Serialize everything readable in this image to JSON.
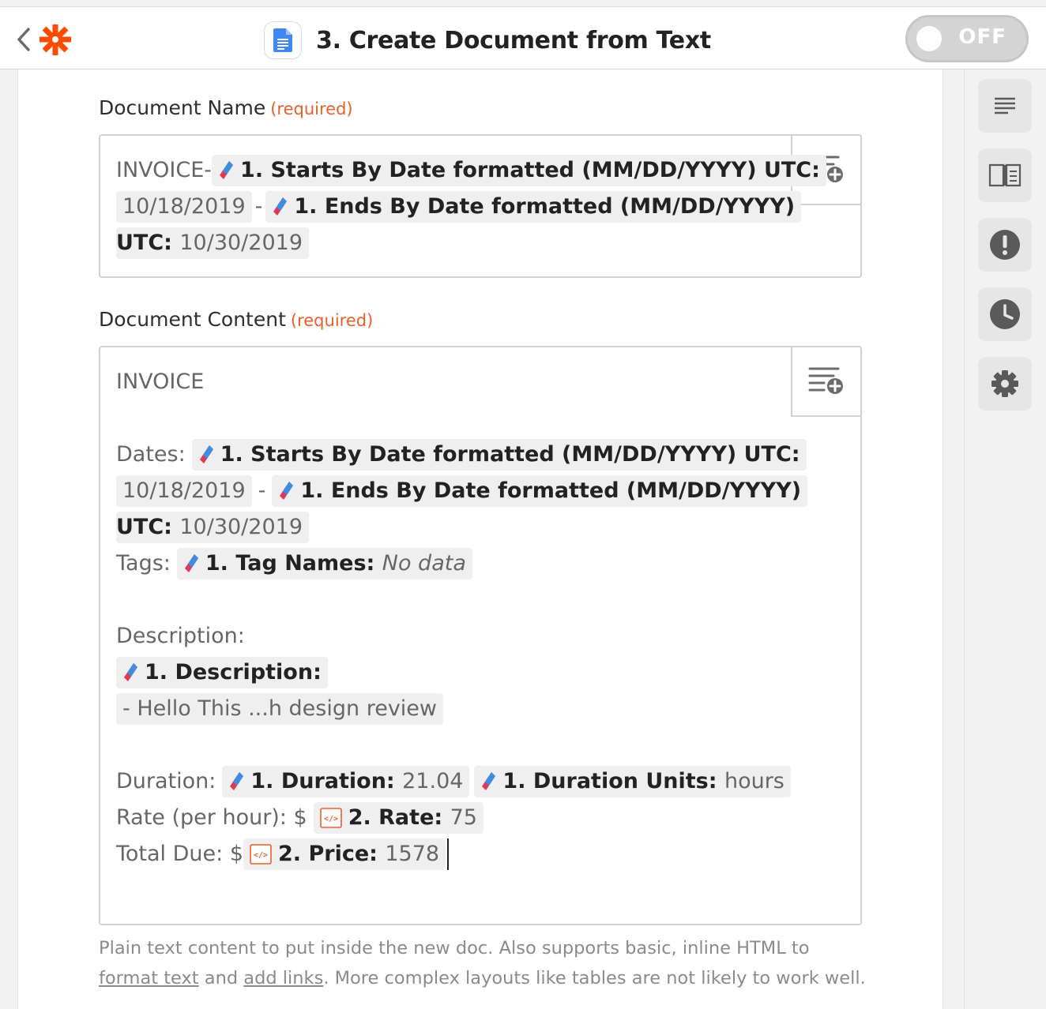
{
  "header": {
    "title": "3. Create Document from Text",
    "toggle_label": "OFF",
    "brand_color": "#ff4a00"
  },
  "document_name": {
    "label": "Document Name",
    "required": "(required)",
    "line1_prefix": "INVOICE-",
    "line1_pill": "1. Starts By Date formatted (MM/DD/YYYY) UTC:",
    "line2_date": "10/18/2019",
    "line2_sep": "-",
    "line2_pill": "1. Ends By Date formatted (MM/DD/YYYY)",
    "line3_key": "UTC:",
    "line3_val": "10/30/2019"
  },
  "document_content": {
    "label": "Document Content",
    "required": "(required)",
    "title": "INVOICE",
    "dates_label": "Dates:",
    "dates_pill": "1. Starts By Date formatted (MM/DD/YYYY) UTC:",
    "dates_start": "10/18/2019",
    "dates_sep": "-",
    "dates_end_pill": "1. Ends By Date formatted (MM/DD/YYYY)",
    "dates_end_key": "UTC:",
    "dates_end_val": "10/30/2019",
    "tags_label": "Tags:",
    "tags_key": "1. Tag Names:",
    "tags_val": "No data",
    "description_label": "Description:",
    "description_key": "1. Description:",
    "description_val": "- Hello This ...h design review",
    "duration_label": "Duration:",
    "duration_key": "1. Duration:",
    "duration_val": "21.04",
    "units_key": "1. Duration Units:",
    "units_val": "hours",
    "rate_label": "Rate (per hour): $",
    "rate_key": "2. Rate:",
    "rate_val": "75",
    "total_label": "Total Due: $",
    "price_key": "2. Price:",
    "price_val": "1578"
  },
  "help": {
    "text1": "Plain text content to put inside the new doc. Also supports basic, inline HTML to",
    "link1": "format text",
    "and": " and ",
    "link2": "add links",
    "text2": ". More complex layouts like tables are not likely to work well."
  },
  "sidebar": {
    "items": [
      "list-icon",
      "book-icon",
      "alert-icon",
      "clock-icon",
      "gear-icon"
    ]
  }
}
